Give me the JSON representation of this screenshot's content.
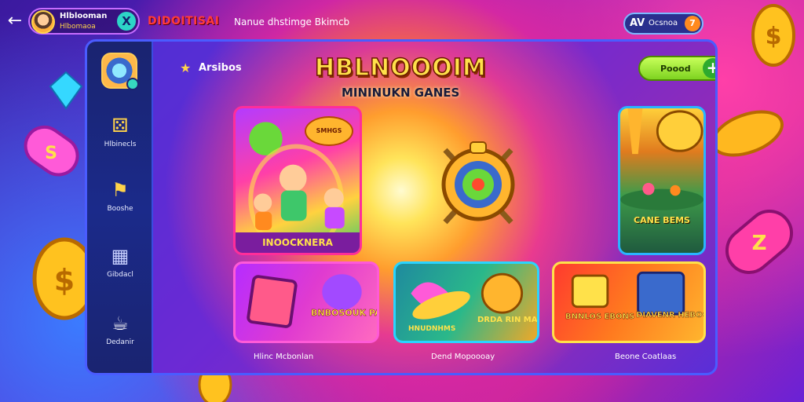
{
  "topbar": {
    "back_icon": "arrow-left-icon",
    "profile": {
      "name": "Hlblooman",
      "subtitle": "Hlbomaoa"
    },
    "x_badge": "X",
    "brand": "DIDOITISAI",
    "brand_subtitle": "Nanue dhstimge Bkimcb",
    "right_pill": {
      "icon": "AV",
      "label": "Ocsnoa",
      "badge": "7"
    }
  },
  "sidebar": {
    "items": [
      {
        "label": "Hlbinecls",
        "icon": "dice-icon"
      },
      {
        "label": "Booshe",
        "icon": "puzzle-icon"
      },
      {
        "label": "Gibdacl",
        "icon": "grid-icon"
      },
      {
        "label": "Dedanir",
        "icon": "ghost-icon"
      }
    ]
  },
  "header": {
    "section_label": "Arsibos",
    "section_icon": "star-icon",
    "title": "HBLNOOOIM",
    "subtitle": "MININUKN GANES",
    "play_button": "Poood",
    "play_plus": "+",
    "avatar_icon": "dog-avatar-icon"
  },
  "cards": {
    "featured": {
      "label": "INOOCKNERA",
      "badge": "SMHGS"
    },
    "right": {
      "label": "CANE BEMS"
    },
    "bottom_1": {
      "label": "BNBOSOUK PARES"
    },
    "bottom_2": {
      "label_left": "HNUDNHMS",
      "label_right": "DRDA RIN MARES"
    },
    "bottom_3": {
      "label_left": "BNNLOS EBONS",
      "label_right": "DIAVENR HEBOONS"
    }
  },
  "footers": [
    "Hlinc Mcbonlan",
    "Dend Mopoooay",
    "Beone Coatlaas"
  ],
  "colors": {
    "accent_yellow": "#ffe14a",
    "sidebar": "#1a2470",
    "window_border": "#4a5cff",
    "play_green": "#7ed321"
  }
}
